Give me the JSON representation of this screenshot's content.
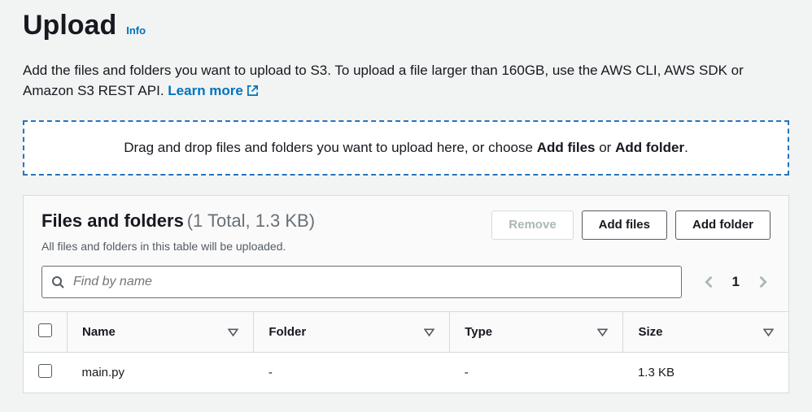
{
  "header": {
    "title": "Upload",
    "info_label": "Info"
  },
  "description": {
    "text": "Add the files and folders you want to upload to S3. To upload a file larger than 160GB, use the AWS CLI, AWS SDK or Amazon S3 REST API. ",
    "learn_more_label": "Learn more"
  },
  "dropzone": {
    "prefix": "Drag and drop files and folders you want to upload here, or choose ",
    "bold1": "Add files",
    "mid": " or ",
    "bold2": "Add folder",
    "suffix": "."
  },
  "panel": {
    "title": "Files and folders",
    "count_text": "(1 Total, 1.3 KB)",
    "subtitle": "All files and folders in this table will be uploaded.",
    "buttons": {
      "remove": "Remove",
      "add_files": "Add files",
      "add_folder": "Add folder"
    },
    "search": {
      "placeholder": "Find by name"
    },
    "pagination": {
      "current": "1"
    },
    "table": {
      "headers": {
        "name": "Name",
        "folder": "Folder",
        "type": "Type",
        "size": "Size"
      },
      "rows": [
        {
          "name": "main.py",
          "folder": "-",
          "type": "-",
          "size": "1.3 KB"
        }
      ]
    }
  }
}
